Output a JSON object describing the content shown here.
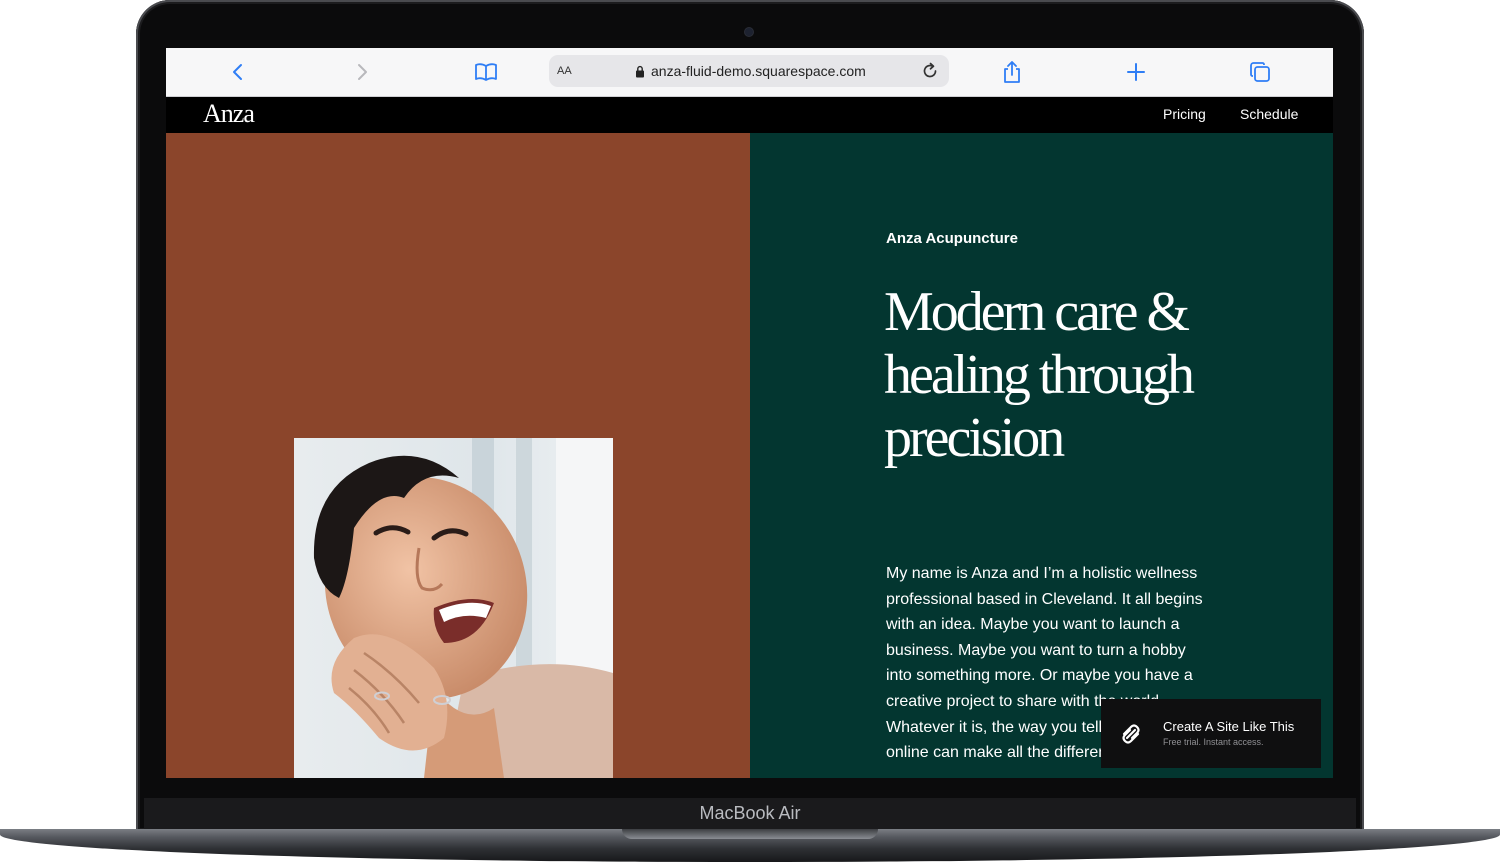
{
  "device": {
    "brand_label": "MacBook Air"
  },
  "browser": {
    "url": "anza-fluid-demo.squarespace.com",
    "text_size_label": "AA",
    "icons": [
      "back-chevron-icon",
      "forward-chevron-icon",
      "bookmarks-icon",
      "lock-icon",
      "reload-icon",
      "share-icon",
      "new-tab-plus-icon",
      "tabs-icon"
    ],
    "accent_color": "#2f7ef5"
  },
  "site": {
    "logo": "Anza",
    "nav": {
      "pricing": "Pricing",
      "schedule": "Schedule"
    },
    "hero": {
      "kicker": "Anza Acupuncture",
      "headline": "Modern care & healing through precision",
      "body": "My name is Anza and I’m a holistic wellness professional based in Cleveland. It all begins with an idea. Maybe you want to launch a business. Maybe you want to turn a hobby into something more. Or maybe you have a creative project to share with the world. Whatever it is, the way you tell your story online can make all the difference."
    },
    "colors": {
      "left_panel": "#8b452b",
      "right_panel": "#033630",
      "nav_bg": "#000000"
    }
  },
  "cta_badge": {
    "title": "Create A Site Like This",
    "subtitle": "Free trial. Instant access.",
    "icon": "squarespace-logo-icon"
  }
}
